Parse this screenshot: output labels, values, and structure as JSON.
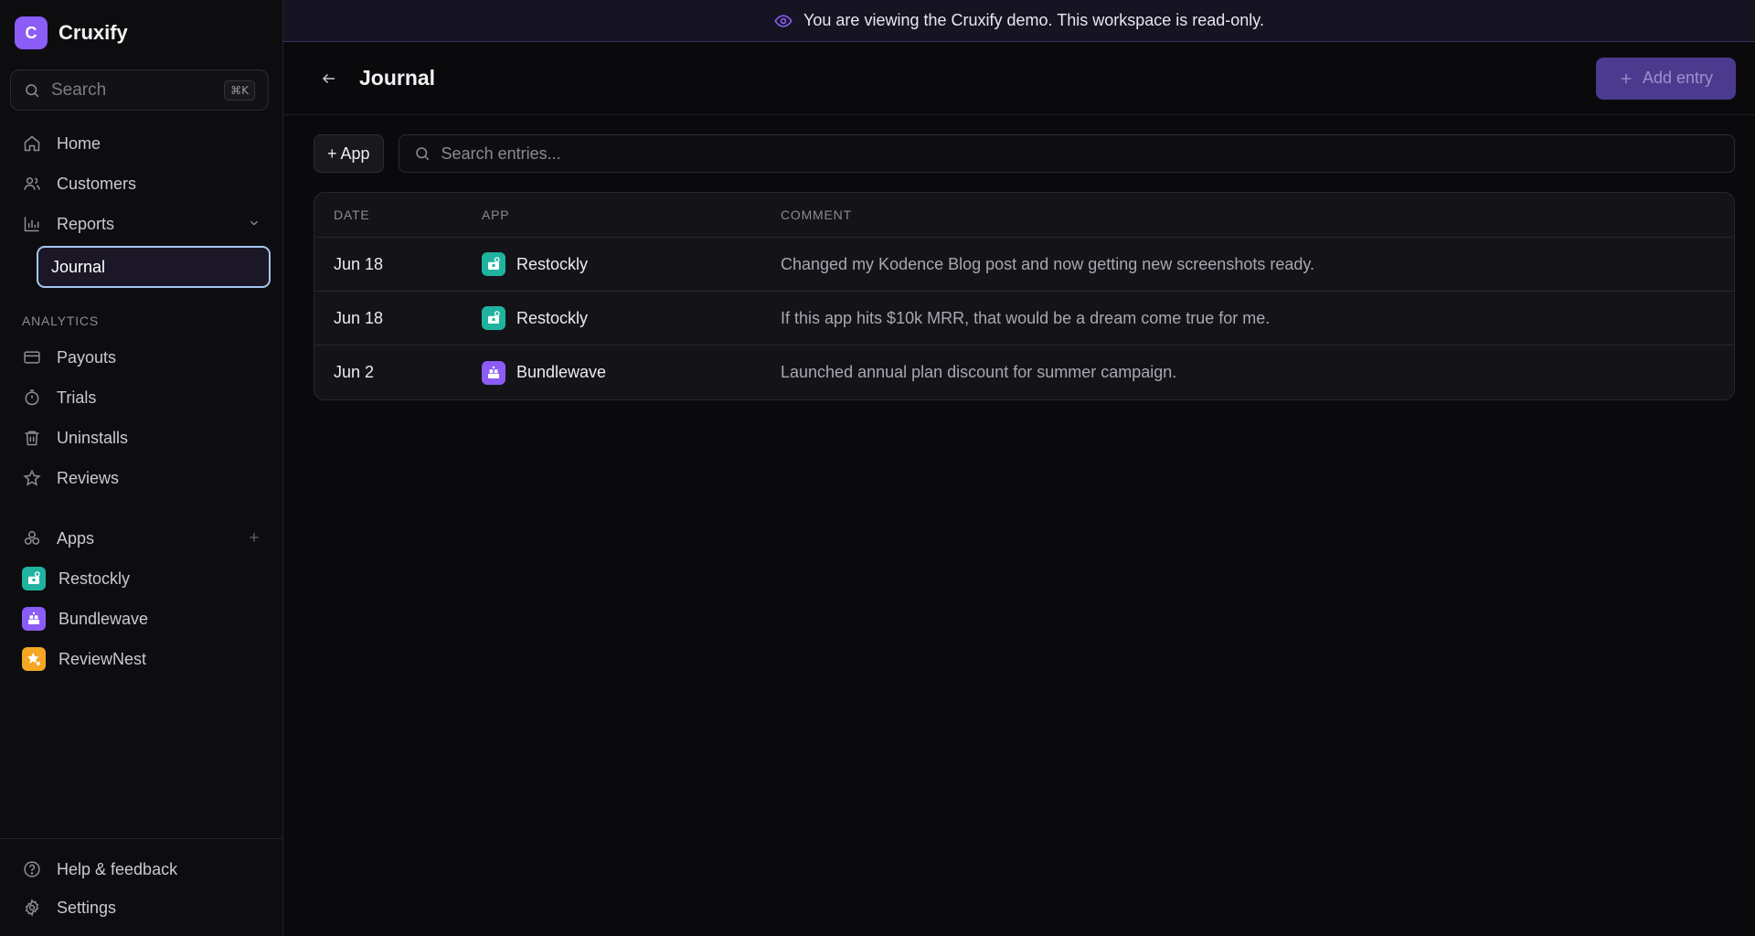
{
  "brand": {
    "initial": "C",
    "name": "Cruxify"
  },
  "search": {
    "placeholder": "Search",
    "shortcut": "⌘K"
  },
  "nav": {
    "home": "Home",
    "customers": "Customers",
    "reports": "Reports",
    "journal": "Journal"
  },
  "analytics": {
    "label": "ANALYTICS",
    "items": [
      "Payouts",
      "Trials",
      "Uninstalls",
      "Reviews"
    ]
  },
  "apps": {
    "label": "Apps",
    "items": [
      {
        "name": "Restockly",
        "color": "#1fb3a0"
      },
      {
        "name": "Bundlewave",
        "color": "#8b5cf6"
      },
      {
        "name": "ReviewNest",
        "color": "#f5a623"
      }
    ]
  },
  "footer": {
    "help": "Help & feedback",
    "settings": "Settings"
  },
  "banner": {
    "text": "You are viewing the Cruxify demo. This workspace is read-only."
  },
  "page": {
    "title": "Journal",
    "add_entry": "Add entry"
  },
  "toolbar": {
    "app_filter": "+ App",
    "search_placeholder": "Search entries..."
  },
  "table": {
    "headers": [
      "DATE",
      "APP",
      "COMMENT"
    ],
    "rows": [
      {
        "date": "Jun 18",
        "app": "Restockly",
        "comment": "Changed my Kodence Blog post and now getting new screenshots ready."
      },
      {
        "date": "Jun 18",
        "app": "Restockly",
        "comment": "If this app hits $10k MRR, that would be a dream come true for me."
      },
      {
        "date": "Jun 2",
        "app": "Bundlewave",
        "comment": "Launched annual plan discount for summer campaign."
      }
    ]
  },
  "colors": {
    "accent": "#8b5cf6",
    "banner_bg": "#161422",
    "selected_border": "#a5c6f0"
  }
}
